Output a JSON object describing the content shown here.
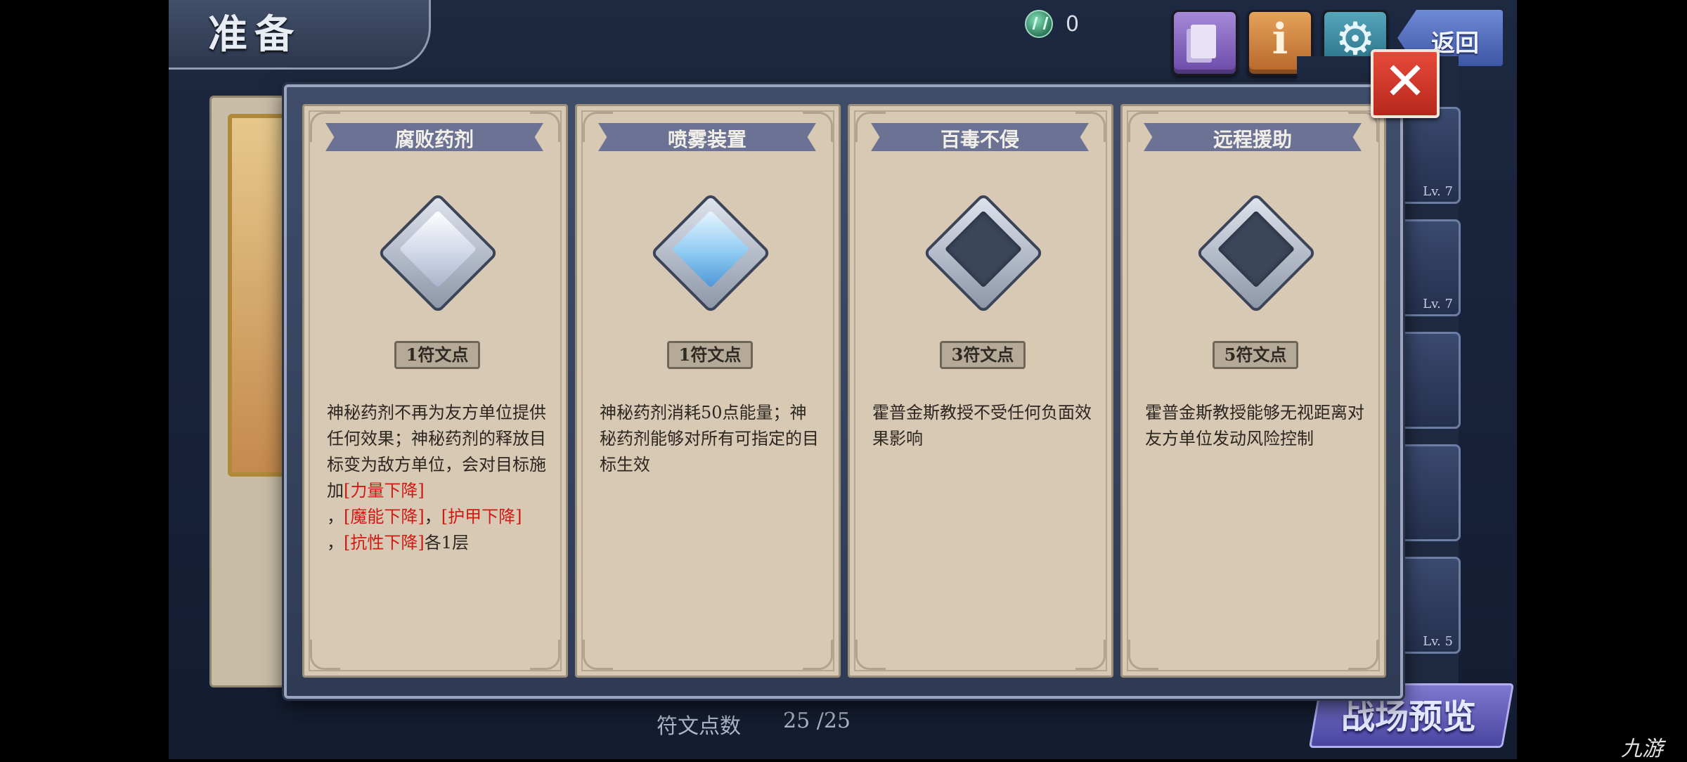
{
  "header": {
    "title": "准备",
    "gem_count": "0",
    "back_label": "返回"
  },
  "modal": {
    "cards": [
      {
        "title": "腐败药剂",
        "cost": "1符文点",
        "state": "white",
        "desc": [
          "神秘药剂不再为友方单位提供任何效果；神秘药剂的释放目标变为敌方单位，会对目标施加",
          "[力量下降]",
          "，",
          "[魔能下降]",
          "，",
          "[护甲下降]",
          "，",
          "[抗性下降]",
          "各1层"
        ]
      },
      {
        "title": "喷雾装置",
        "cost": "1符文点",
        "state": "blue",
        "desc": "神秘药剂消耗50点能量；神秘药剂能够对所有可指定的目标生效"
      },
      {
        "title": "百毒不侵",
        "cost": "3符文点",
        "state": "dark",
        "desc": "霍普金斯教授不受任何负面效果影响"
      },
      {
        "title": "远程援助",
        "cost": "5符文点",
        "state": "dark",
        "desc": "霍普金斯教授能够无视距离对友方单位发动风险控制"
      }
    ]
  },
  "background": {
    "hero_levels": [
      "Lv. 7",
      "Lv. 7",
      "",
      "",
      "Lv. 5"
    ],
    "battle_preview_label": "战场预览",
    "rune_points_label": "符文点数",
    "rune_points_value": "25 /25"
  },
  "watermark": "九游",
  "colors": {
    "debuff_red": "#d01a14",
    "card_bg": "#d8c9b5",
    "title_bar": "#6c7293",
    "close_red": "#e74a3a"
  }
}
